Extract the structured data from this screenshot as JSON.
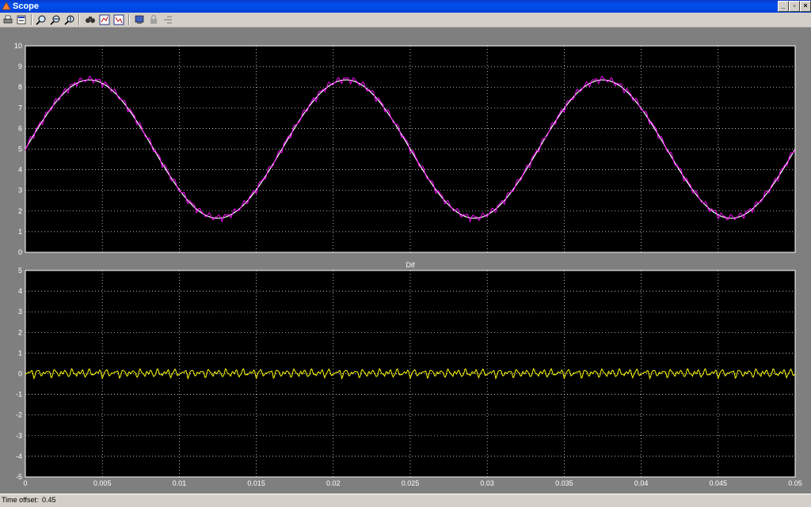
{
  "window": {
    "title": "Scope"
  },
  "toolbar": {
    "buttons": [
      {
        "name": "print-icon"
      },
      {
        "name": "parameters-icon"
      },
      {
        "name": "zoom-icon"
      },
      {
        "name": "zoom-x-icon"
      },
      {
        "name": "zoom-y-icon"
      },
      {
        "name": "autoscale-icon"
      },
      {
        "name": "save-axes-icon"
      },
      {
        "name": "restore-axes-icon"
      },
      {
        "name": "floating-scope-icon"
      },
      {
        "name": "lock-axes-icon"
      },
      {
        "name": "signal-selection-icon"
      }
    ]
  },
  "status": {
    "label": "Time offset:",
    "value": "0.45"
  },
  "colors": {
    "signal": "#ff00ff",
    "reference": "#ffffff",
    "difference": "#ffff00",
    "grid": "#ffffff",
    "plot_bg": "#000000"
  },
  "chart_data": [
    {
      "type": "line",
      "title": "",
      "xlim": [
        0,
        0.05
      ],
      "ylim": [
        0,
        10
      ],
      "x_ticks": [
        "0",
        "0.005",
        "0.01",
        "0.015",
        "0.02",
        "0.025",
        "0.03",
        "0.035",
        "0.04",
        "0.045",
        "0.05"
      ],
      "y_ticks": [
        "0",
        "1",
        "2",
        "3",
        "4",
        "5",
        "6",
        "7",
        "8",
        "9",
        "10"
      ],
      "grid": true,
      "series": [
        {
          "color": "#ffffff",
          "offset": 5.0,
          "amplitude": 3.35,
          "frequency_hz": 60,
          "phase_deg": 0
        },
        {
          "color": "#ff00ff",
          "offset": 5.0,
          "amplitude": 3.35,
          "frequency_hz": 60,
          "phase_deg": 0,
          "ripple": 0.25
        }
      ]
    },
    {
      "type": "line",
      "title": "Dif",
      "xlim": [
        0,
        0.05
      ],
      "ylim": [
        -5,
        5
      ],
      "x_ticks": [
        "0",
        "0.005",
        "0.01",
        "0.015",
        "0.02",
        "0.025",
        "0.03",
        "0.035",
        "0.04",
        "0.045",
        "0.05"
      ],
      "y_ticks": [
        "-5",
        "-4",
        "-3",
        "-2",
        "-1",
        "0",
        "1",
        "2",
        "3",
        "4",
        "5"
      ],
      "grid": true,
      "series": [
        {
          "color": "#ffff00",
          "mean": 0.0,
          "ripple": 0.25
        }
      ]
    }
  ]
}
